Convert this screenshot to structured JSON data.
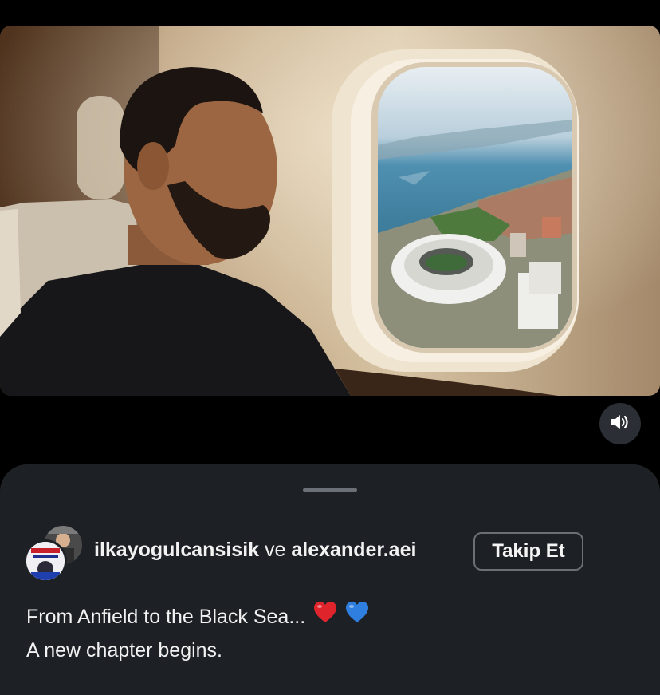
{
  "post": {
    "sound_icon": "speaker-volume-icon"
  },
  "sheet": {
    "users": {
      "first": "ilkayogulcansisik",
      "conjunction": "ve",
      "second": "alexander.aei"
    },
    "follow_label": "Takip Et",
    "caption": {
      "line1": "From Anfield to the Black Sea...",
      "line2": "A new chapter begins.",
      "emoji": [
        "red-heart-icon",
        "blue-heart-icon"
      ]
    }
  },
  "colors": {
    "red_heart": "#e0242c",
    "blue_heart": "#2f7fe0"
  }
}
